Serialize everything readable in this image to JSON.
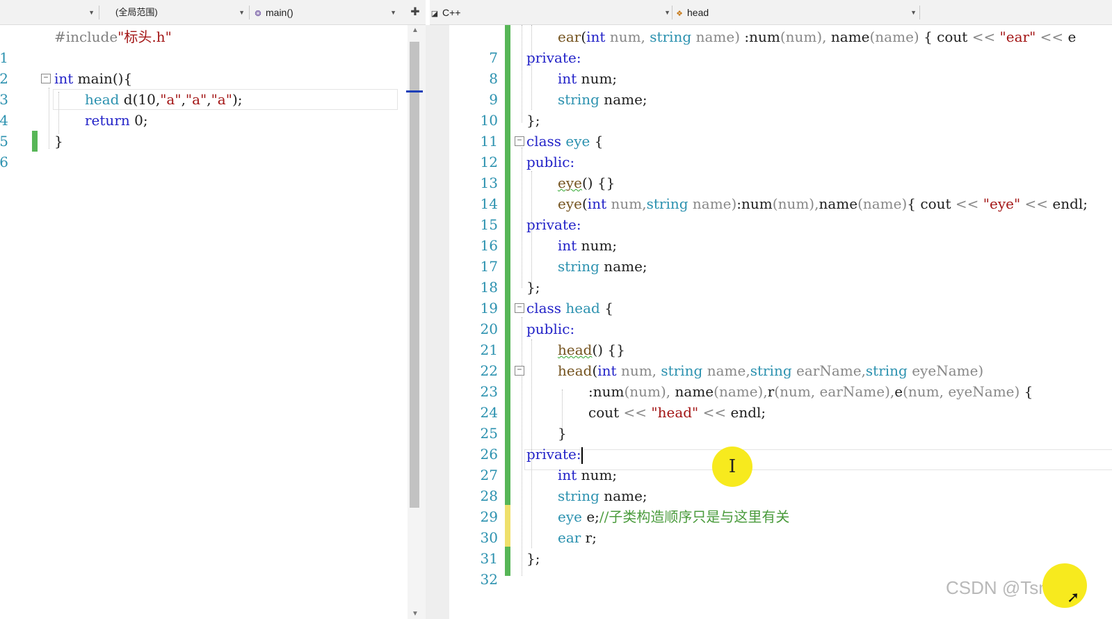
{
  "left_nav": {
    "scope_label": "(全局范围)",
    "member_label": "main()",
    "split_icon": "plus-split-icon"
  },
  "right_nav": {
    "language_label": "C++",
    "member_label": "head"
  },
  "left_editor": {
    "lines": [
      {
        "num": "1"
      },
      {
        "num": "2"
      },
      {
        "num": "3"
      },
      {
        "num": "4"
      },
      {
        "num": "5"
      },
      {
        "num": "6"
      }
    ],
    "tokens": {
      "l1_pp": "#include",
      "l1_str": "\"标头.h\"",
      "l3_kw": "int",
      "l3_rest": " main(){",
      "l4_ty": "head",
      "l4_a": " d(10,",
      "l4_s1": "\"a\"",
      "l4_c1": ",",
      "l4_s2": "\"a\"",
      "l4_c2": ",",
      "l4_s3": "\"a\"",
      "l4_end": ");",
      "l5_kw": "return",
      "l5_rest": " 0;",
      "l6": "}"
    }
  },
  "right_editor": {
    "lines": [
      {
        "num": "7"
      },
      {
        "num": "8"
      },
      {
        "num": "9"
      },
      {
        "num": "10"
      },
      {
        "num": "11"
      },
      {
        "num": "12"
      },
      {
        "num": "13"
      },
      {
        "num": "14"
      },
      {
        "num": "15"
      },
      {
        "num": "16"
      },
      {
        "num": "17"
      },
      {
        "num": "18"
      },
      {
        "num": "19"
      },
      {
        "num": "20"
      },
      {
        "num": "21"
      },
      {
        "num": "22"
      },
      {
        "num": "23"
      },
      {
        "num": "24"
      },
      {
        "num": "25"
      },
      {
        "num": "26"
      },
      {
        "num": "27"
      },
      {
        "num": "28"
      },
      {
        "num": "29"
      },
      {
        "num": "30"
      },
      {
        "num": "31"
      },
      {
        "num": "32"
      }
    ],
    "code": {
      "l7": {
        "fn": "ear",
        "p1": "(",
        "k1": "int",
        "v1": " num,",
        "k2": " string",
        "v2": " name)",
        "i1": " :num",
        "v3": "(num),",
        "i2": " name",
        "v4": "(name)",
        "b": " { cout ",
        "op": "<<",
        "s": " \"ear\"",
        "op2": " <<",
        "e": " e"
      },
      "l8": "private:",
      "l9": {
        "k": "int",
        "r": " num;"
      },
      "l10": {
        "k": "string",
        "r": " name;"
      },
      "l11": "};",
      "l12": {
        "k": "class",
        "t": " eye",
        "r": " {"
      },
      "l13": "public:",
      "l14": {
        "f": "eye",
        "r": "() {}"
      },
      "l15": {
        "fn": "eye",
        "p1": "(",
        "k1": "int",
        "v1": " num,",
        "k2": "string",
        "v2": " name)",
        "i1": ":num",
        "v3": "(num),",
        "i2": "name",
        "v4": "(name)",
        "b": "{ cout ",
        "op": "<<",
        "s": " \"eye\"",
        "op2": " <<",
        "e": " endl;"
      },
      "l16": "private:",
      "l17": {
        "k": "int",
        "r": " num;"
      },
      "l18": {
        "k": "string",
        "r": " name;"
      },
      "l19": "};",
      "l20": {
        "k": "class",
        "t": " head",
        "r": " {"
      },
      "l21": "public:",
      "l22": {
        "f": "head",
        "r": "() {}"
      },
      "l23": {
        "fn": "head",
        "p1": "(",
        "k1": "int",
        "v1": " num,",
        "k2": " string",
        "v2": " name,",
        "k3": "string",
        "v3": " earName,",
        "k4": "string",
        "v4": " eyeName)"
      },
      "l24": {
        "a": ":num",
        "b": "(num),",
        "c": " name",
        "d": "(name),",
        "e": "r",
        "f": "(num, earName),",
        "g": "e",
        "h": "(num, eyeName)",
        "i": " {"
      },
      "l25": {
        "a": "cout ",
        "op": "<<",
        "s": " \"head\"",
        "op2": " <<",
        "e": " endl;"
      },
      "l26": "}",
      "l27": "private:",
      "l28": {
        "k": "int",
        "r": " num;"
      },
      "l29": {
        "k": "string",
        "r": " name;"
      },
      "l30": {
        "t": "eye",
        "r": " e;",
        "c": "//子类构造顺序只是与这里有关"
      },
      "l31": {
        "t": "ear",
        "r": " r;"
      },
      "l32": "};"
    }
  },
  "cursor_glyph": "I",
  "watermark": "CSDN @Tsmall_"
}
